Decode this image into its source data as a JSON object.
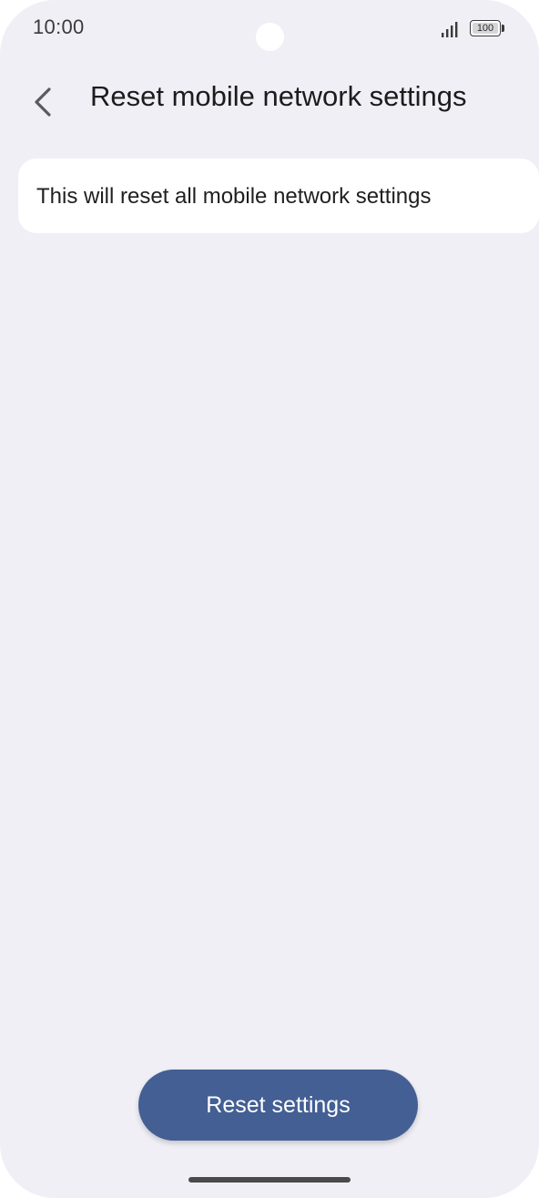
{
  "status_bar": {
    "time": "10:00",
    "signal_icon": "signal-bars-icon",
    "battery_level": "100"
  },
  "header": {
    "back_icon": "chevron-left-icon",
    "title": "Reset mobile network settings"
  },
  "info_card": {
    "text": "This will reset all mobile network settings"
  },
  "actions": {
    "reset_label": "Reset settings"
  },
  "colors": {
    "background": "#efeff5",
    "card": "#ffffff",
    "primary_button": "#435f94",
    "text": "#1c1c1e"
  }
}
